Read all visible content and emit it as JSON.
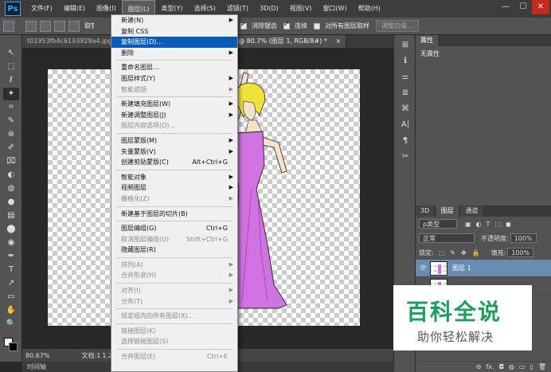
{
  "menubar": {
    "logo": "Ps",
    "items": [
      "文件(F)",
      "编辑(E)",
      "图像(I)",
      "图层(L)",
      "类型(Y)",
      "选择(S)",
      "滤镜(T)",
      "3D(D)",
      "视图(V)",
      "窗口(W)",
      "帮助(H)"
    ],
    "window_buttons": [
      "—",
      "☐",
      "✕"
    ]
  },
  "options": {
    "partial_label": "取钅",
    "anti_alias": "消除锯齿",
    "contiguous": "连续",
    "sample_all": "对所有图层取样",
    "refine_edge": "调整边缘..."
  },
  "tabs": {
    "left": "t01953fb4c6193929a4.jpg @ 6",
    "right": ".jpg @ 80.7% (图层 1, RGB/8#) *",
    "close": "×"
  },
  "toolbox": {
    "tools": [
      "↖",
      "⬚",
      "ℓ",
      "✦",
      "⌗",
      "✎",
      "⊕",
      "✐",
      "⌧",
      "◐",
      "◍",
      "●",
      "▤",
      "⬤",
      "◉",
      "✒",
      "T",
      "↗",
      "▭",
      "✋",
      "🔍"
    ]
  },
  "status": {
    "zoom": "80.67%",
    "doc": "文档:1",
    "doc_rest": "1.26"
  },
  "timeline": {
    "label": "时间轴"
  },
  "layer_menu": {
    "items": [
      {
        "label": "新建(N)",
        "arrow": true,
        "disabled": false
      },
      {
        "label": "复制 CSS",
        "disabled": false
      },
      {
        "label": "复制图层(D)...",
        "highlighted": true
      },
      {
        "label": "删除",
        "arrow": true
      },
      {
        "sep": true
      },
      {
        "label": "重命名图层..."
      },
      {
        "label": "图层样式(Y)",
        "arrow": true
      },
      {
        "label": "智能滤镜",
        "arrow": true,
        "disabled": true
      },
      {
        "sep": true
      },
      {
        "label": "新建填充图层(W)",
        "arrow": true
      },
      {
        "label": "新建调整图层(J)",
        "arrow": true
      },
      {
        "label": "图层内容选项(O)...",
        "disabled": true
      },
      {
        "sep": true
      },
      {
        "label": "图层蒙版(M)",
        "arrow": true
      },
      {
        "label": "矢量蒙版(V)",
        "arrow": true
      },
      {
        "label": "创建剪贴蒙版(C)",
        "shortcut": "Alt+Ctrl+G"
      },
      {
        "sep": true
      },
      {
        "label": "智能对象",
        "arrow": true
      },
      {
        "label": "视频图层",
        "arrow": true
      },
      {
        "label": "栅格化(Z)",
        "arrow": true,
        "disabled": true
      },
      {
        "sep": true
      },
      {
        "label": "新建基于图层的切片(B)"
      },
      {
        "sep": true
      },
      {
        "label": "图层编组(G)",
        "shortcut": "Ctrl+G"
      },
      {
        "label": "取消图层编组(U)",
        "shortcut": "Shift+Ctrl+G",
        "disabled": true
      },
      {
        "label": "隐藏图层(R)"
      },
      {
        "sep": true
      },
      {
        "label": "排列(A)",
        "arrow": true,
        "disabled": true
      },
      {
        "label": "合并形状(H)",
        "arrow": true,
        "disabled": true
      },
      {
        "sep": true
      },
      {
        "label": "对齐(I)",
        "arrow": true,
        "disabled": true
      },
      {
        "label": "分布(T)",
        "arrow": true,
        "disabled": true
      },
      {
        "sep": true
      },
      {
        "label": "锁定组内的所有图层(X)...",
        "disabled": true
      },
      {
        "sep": true
      },
      {
        "label": "链接图层(K)",
        "disabled": true
      },
      {
        "label": "选择链接图层(S)",
        "disabled": true
      },
      {
        "sep": true
      },
      {
        "label": "合并图层(E)",
        "shortcut": "Ctrl+E",
        "disabled": true
      }
    ]
  },
  "mini_panel": {
    "icons": [
      "⊞",
      "ℹ",
      "⚌",
      "≣",
      "⌘",
      "A|",
      "¶",
      "✂"
    ]
  },
  "props": {
    "tab": "属性",
    "body": "无属性"
  },
  "layers": {
    "tabs": [
      "3D",
      "图层",
      "通道"
    ],
    "kind_label": "ρ类型",
    "kind_icons": [
      "▣",
      "◐",
      "T",
      "⬚",
      "◼"
    ],
    "blend_mode": "正常",
    "opacity_label": "不透明度:",
    "opacity_value": "100%",
    "lock_label": "锁定:",
    "lock_icons": [
      "⬚",
      "✎",
      "✥",
      "🔒"
    ],
    "fill_label": "填充:",
    "fill_value": "100%",
    "layer_name": "图层 1",
    "eye": "👁",
    "bottom_icons": [
      "⊖",
      "fx.",
      "◘",
      "◍",
      "▭",
      "▯",
      "🗑"
    ]
  },
  "watermark": {
    "title": "百科全说",
    "subtitle": "助你轻松解决"
  },
  "colors": {
    "highlight": "#0a5bb5",
    "dress": "#cf73e0",
    "hair": "#f2e03a",
    "watermark_green": "#1c9f5c"
  }
}
